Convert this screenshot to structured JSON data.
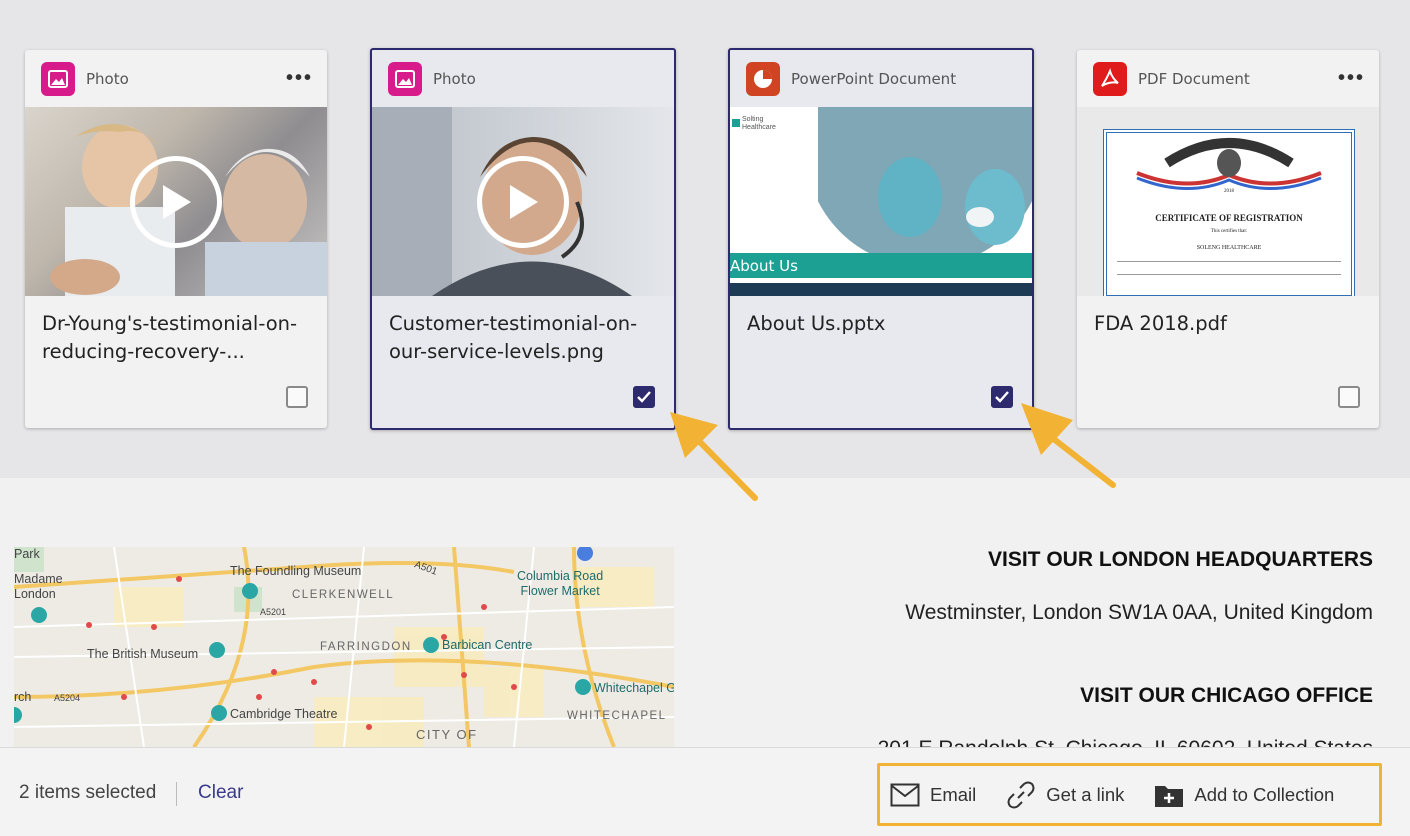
{
  "cards": [
    {
      "type_label": "Photo",
      "title": "Dr-Young's-testimonial-on-reducing-recovery-...",
      "selected": false,
      "icon": "image-icon",
      "color": "#d81b8b"
    },
    {
      "type_label": "Photo",
      "title": "Customer-testimonial-on-our-service-levels.png",
      "selected": true,
      "icon": "image-icon",
      "color": "#d81b8b"
    },
    {
      "type_label": "PowerPoint Document",
      "title": "About Us.pptx",
      "selected": true,
      "icon": "powerpoint-icon",
      "color": "#d04423"
    },
    {
      "type_label": "PDF Document",
      "title": "FDA 2018.pdf",
      "selected": false,
      "icon": "pdf-icon",
      "color": "#e01b1b"
    }
  ],
  "thumbnails": {
    "pptx_banner": "About Us",
    "pptx_logo": "Solting Healthcare",
    "pdf_heading": "CERTIFICATE OF REGISTRATION",
    "pdf_line1": "This certifies that:",
    "pdf_line2": "SOLENG HEALTHCARE",
    "pdf_year": "2018"
  },
  "map": {
    "labels": {
      "park": "Park",
      "tussauds": "Madame\nLondon",
      "foundling": "The Foundling Museum",
      "clerkenwell": "CLERKENWELL",
      "columbia": "Columbia Road\nFlower Market",
      "british_museum": "The British Museum",
      "farringdon": "FARRINGDON",
      "barbican": "Barbican Centre",
      "whitechapel_gallery": "Whitechapel G",
      "cambridge": "Cambridge Theatre",
      "whitechapel": "WHITECHAPEL",
      "city": "CITY OF",
      "rch": "rch",
      "a501": "A501",
      "a5201": "A5201",
      "a5204": "A5204"
    }
  },
  "offices": [
    {
      "title": "VISIT OUR LONDON HEADQUARTERS",
      "address": "Westminster, London SW1A 0AA, United Kingdom"
    },
    {
      "title": "VISIT OUR CHICAGO OFFICE",
      "address": "201 E Randolph St, Chicago, IL 60602, United States"
    }
  ],
  "selection": {
    "count_text": "2 items selected",
    "clear_label": "Clear"
  },
  "actions": {
    "email": "Email",
    "link": "Get a link",
    "collection": "Add to Collection"
  },
  "colors": {
    "accent": "#2d2a6e",
    "highlight": "#f2b233",
    "photo": "#d81b8b",
    "ppt": "#d04423",
    "pdf": "#e01b1b"
  }
}
